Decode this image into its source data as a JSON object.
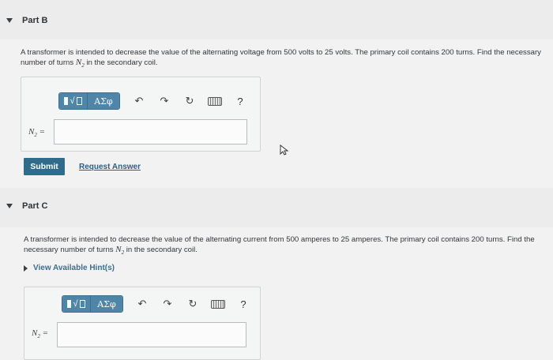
{
  "part_b": {
    "title": "Part B",
    "problem_text": "A transformer is intended to decrease the value of the alternating voltage from 500 volts to 25 volts. The primary coil contains 200 turns. Find the necessary number of turns ",
    "problem_var": "N",
    "problem_sub": "2",
    "problem_tail": " in the secondary coil.",
    "answer_label_var": "N",
    "answer_label_sub": "2",
    "answer_label_eq": " =",
    "answer_value": "",
    "submit_label": "Submit",
    "request_answer_label": "Request Answer"
  },
  "part_c": {
    "title": "Part C",
    "problem_text": "A transformer is intended to decrease the value of the alternating current from 500 amperes to 25 amperes. The primary coil contains 200 turns. Find the necessary number of turns ",
    "problem_var": "N",
    "problem_sub": "2",
    "problem_tail": " in the secondary coil.",
    "hint_label": "View Available Hint(s)",
    "answer_label_var": "N",
    "answer_label_sub": "2",
    "answer_label_eq": " =",
    "answer_value": ""
  },
  "toolbar": {
    "greek_label": "ΑΣφ",
    "help_label": "?",
    "undo_glyph": "↶",
    "redo_glyph": "↷",
    "reset_glyph": "↻"
  }
}
